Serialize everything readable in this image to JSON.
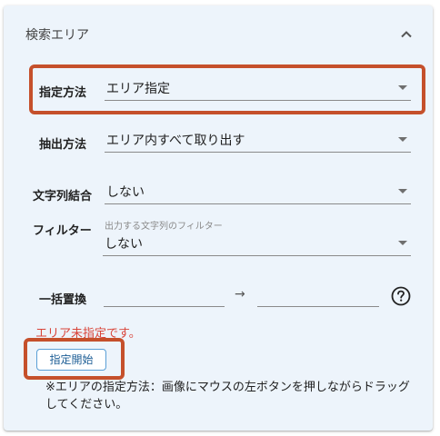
{
  "panel": {
    "title": "検索エリア",
    "collapse_icon": "chevron-up-icon"
  },
  "form": {
    "method": {
      "label": "指定方法",
      "value": "エリア指定"
    },
    "extract": {
      "label": "抽出方法",
      "value": "エリア内すべて取り出す"
    },
    "join": {
      "label": "文字列結合",
      "value": "しない"
    },
    "filter": {
      "label": "フィルター",
      "hint": "出力する文字列のフィルター",
      "value": "しない"
    },
    "replace": {
      "label": "一括置換",
      "from": "",
      "to": "",
      "arrow": "→",
      "help_icon": "help-circle-icon"
    }
  },
  "error": "エリア未指定です。",
  "start_button": "指定開始",
  "note": "※エリアの指定方法：画像にマウスの左ボタンを押しながらドラッグしてください。",
  "colors": {
    "panel_bg": "#edf4fb",
    "highlight": "#c5502b",
    "error": "#d9453a",
    "button_border": "#5a9fd6"
  }
}
